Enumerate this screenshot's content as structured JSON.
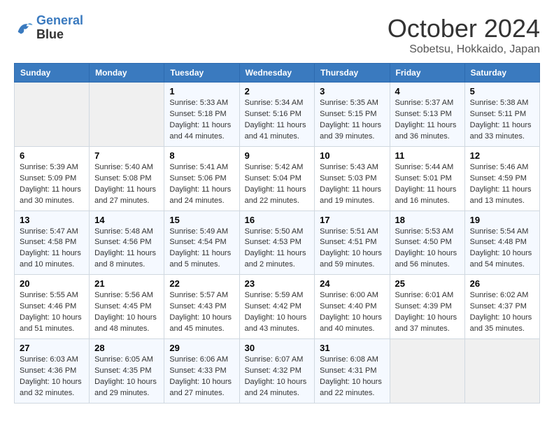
{
  "logo": {
    "line1": "General",
    "line2": "Blue"
  },
  "title": "October 2024",
  "location": "Sobetsu, Hokkaido, Japan",
  "days_header": [
    "Sunday",
    "Monday",
    "Tuesday",
    "Wednesday",
    "Thursday",
    "Friday",
    "Saturday"
  ],
  "weeks": [
    [
      {
        "day": "",
        "info": ""
      },
      {
        "day": "",
        "info": ""
      },
      {
        "day": "1",
        "info": "Sunrise: 5:33 AM\nSunset: 5:18 PM\nDaylight: 11 hours and 44 minutes."
      },
      {
        "day": "2",
        "info": "Sunrise: 5:34 AM\nSunset: 5:16 PM\nDaylight: 11 hours and 41 minutes."
      },
      {
        "day": "3",
        "info": "Sunrise: 5:35 AM\nSunset: 5:15 PM\nDaylight: 11 hours and 39 minutes."
      },
      {
        "day": "4",
        "info": "Sunrise: 5:37 AM\nSunset: 5:13 PM\nDaylight: 11 hours and 36 minutes."
      },
      {
        "day": "5",
        "info": "Sunrise: 5:38 AM\nSunset: 5:11 PM\nDaylight: 11 hours and 33 minutes."
      }
    ],
    [
      {
        "day": "6",
        "info": "Sunrise: 5:39 AM\nSunset: 5:09 PM\nDaylight: 11 hours and 30 minutes."
      },
      {
        "day": "7",
        "info": "Sunrise: 5:40 AM\nSunset: 5:08 PM\nDaylight: 11 hours and 27 minutes."
      },
      {
        "day": "8",
        "info": "Sunrise: 5:41 AM\nSunset: 5:06 PM\nDaylight: 11 hours and 24 minutes."
      },
      {
        "day": "9",
        "info": "Sunrise: 5:42 AM\nSunset: 5:04 PM\nDaylight: 11 hours and 22 minutes."
      },
      {
        "day": "10",
        "info": "Sunrise: 5:43 AM\nSunset: 5:03 PM\nDaylight: 11 hours and 19 minutes."
      },
      {
        "day": "11",
        "info": "Sunrise: 5:44 AM\nSunset: 5:01 PM\nDaylight: 11 hours and 16 minutes."
      },
      {
        "day": "12",
        "info": "Sunrise: 5:46 AM\nSunset: 4:59 PM\nDaylight: 11 hours and 13 minutes."
      }
    ],
    [
      {
        "day": "13",
        "info": "Sunrise: 5:47 AM\nSunset: 4:58 PM\nDaylight: 11 hours and 10 minutes."
      },
      {
        "day": "14",
        "info": "Sunrise: 5:48 AM\nSunset: 4:56 PM\nDaylight: 11 hours and 8 minutes."
      },
      {
        "day": "15",
        "info": "Sunrise: 5:49 AM\nSunset: 4:54 PM\nDaylight: 11 hours and 5 minutes."
      },
      {
        "day": "16",
        "info": "Sunrise: 5:50 AM\nSunset: 4:53 PM\nDaylight: 11 hours and 2 minutes."
      },
      {
        "day": "17",
        "info": "Sunrise: 5:51 AM\nSunset: 4:51 PM\nDaylight: 10 hours and 59 minutes."
      },
      {
        "day": "18",
        "info": "Sunrise: 5:53 AM\nSunset: 4:50 PM\nDaylight: 10 hours and 56 minutes."
      },
      {
        "day": "19",
        "info": "Sunrise: 5:54 AM\nSunset: 4:48 PM\nDaylight: 10 hours and 54 minutes."
      }
    ],
    [
      {
        "day": "20",
        "info": "Sunrise: 5:55 AM\nSunset: 4:46 PM\nDaylight: 10 hours and 51 minutes."
      },
      {
        "day": "21",
        "info": "Sunrise: 5:56 AM\nSunset: 4:45 PM\nDaylight: 10 hours and 48 minutes."
      },
      {
        "day": "22",
        "info": "Sunrise: 5:57 AM\nSunset: 4:43 PM\nDaylight: 10 hours and 45 minutes."
      },
      {
        "day": "23",
        "info": "Sunrise: 5:59 AM\nSunset: 4:42 PM\nDaylight: 10 hours and 43 minutes."
      },
      {
        "day": "24",
        "info": "Sunrise: 6:00 AM\nSunset: 4:40 PM\nDaylight: 10 hours and 40 minutes."
      },
      {
        "day": "25",
        "info": "Sunrise: 6:01 AM\nSunset: 4:39 PM\nDaylight: 10 hours and 37 minutes."
      },
      {
        "day": "26",
        "info": "Sunrise: 6:02 AM\nSunset: 4:37 PM\nDaylight: 10 hours and 35 minutes."
      }
    ],
    [
      {
        "day": "27",
        "info": "Sunrise: 6:03 AM\nSunset: 4:36 PM\nDaylight: 10 hours and 32 minutes."
      },
      {
        "day": "28",
        "info": "Sunrise: 6:05 AM\nSunset: 4:35 PM\nDaylight: 10 hours and 29 minutes."
      },
      {
        "day": "29",
        "info": "Sunrise: 6:06 AM\nSunset: 4:33 PM\nDaylight: 10 hours and 27 minutes."
      },
      {
        "day": "30",
        "info": "Sunrise: 6:07 AM\nSunset: 4:32 PM\nDaylight: 10 hours and 24 minutes."
      },
      {
        "day": "31",
        "info": "Sunrise: 6:08 AM\nSunset: 4:31 PM\nDaylight: 10 hours and 22 minutes."
      },
      {
        "day": "",
        "info": ""
      },
      {
        "day": "",
        "info": ""
      }
    ]
  ]
}
